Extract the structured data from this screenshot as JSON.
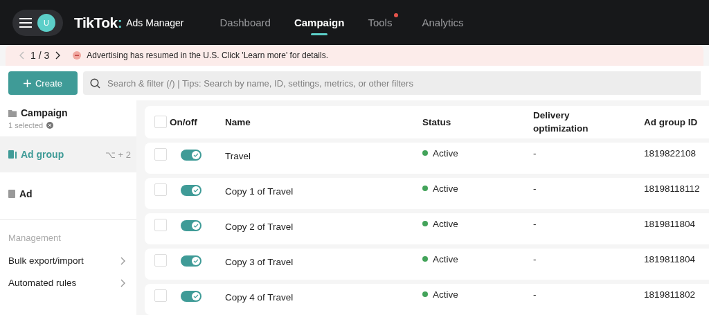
{
  "header": {
    "avatar": "U",
    "logo": "TikTok",
    "logo_mark": ":",
    "logo_suffix": "Ads Manager",
    "tabs": [
      {
        "label": "Dashboard",
        "selected": false,
        "dot": false
      },
      {
        "label": "Campaign",
        "selected": true,
        "dot": false
      },
      {
        "label": "Tools",
        "selected": false,
        "dot": true
      },
      {
        "label": "Analytics",
        "selected": false,
        "dot": false
      }
    ]
  },
  "banner": {
    "pager": "1 / 3",
    "message": "Advertising has resumed in the U.S. Click 'Learn more' for details."
  },
  "toolbar": {
    "create": "Create",
    "search": {
      "placeholder": "Search & filter (/) | Tips: Search by name, ID, settings, metrics, or other filters"
    }
  },
  "sidebar": {
    "levels": [
      {
        "kind": "campaign",
        "label": "Campaign",
        "sub": "1 selected",
        "selected": false
      },
      {
        "kind": "adgroup",
        "label": "Ad group",
        "shortcut": "⌥ + 2",
        "selected": true
      },
      {
        "kind": "ad",
        "label": "Ad",
        "selected": false
      }
    ],
    "section": "Management",
    "links": [
      "Bulk export/import",
      "Automated rules"
    ]
  },
  "table": {
    "all_checked": false,
    "columns": [
      "On/off",
      "Name",
      "Status",
      "Delivery optimization",
      "Ad group ID"
    ],
    "rows": [
      {
        "checked": false,
        "on": true,
        "name": "Travel",
        "status": "Active",
        "delivery": "-",
        "id": "1819822108"
      },
      {
        "checked": false,
        "on": true,
        "name": "Copy 1 of Travel",
        "status": "Active",
        "delivery": "-",
        "id": "18198118112"
      },
      {
        "checked": false,
        "on": true,
        "name": "Copy 2 of Travel",
        "status": "Active",
        "delivery": "-",
        "id": "1819811804"
      },
      {
        "checked": false,
        "on": true,
        "name": "Copy 3 of Travel",
        "status": "Active",
        "delivery": "-",
        "id": "1819811804"
      },
      {
        "checked": false,
        "on": true,
        "name": "Copy 4 of Travel",
        "status": "Active",
        "delivery": "-",
        "id": "1819811802"
      }
    ]
  }
}
